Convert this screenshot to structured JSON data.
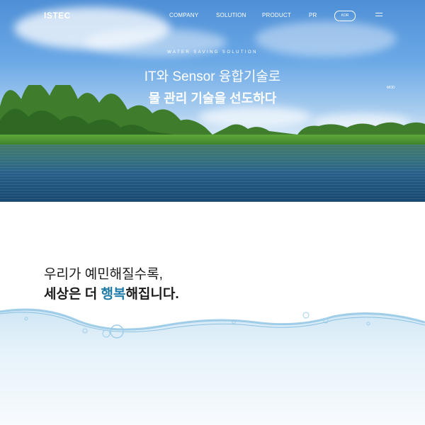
{
  "nav": {
    "logo": "ISTEC",
    "menu": [
      "COMPANY",
      "SOLUTION",
      "PRODUCT",
      "PR"
    ],
    "lang_pill": "KOR"
  },
  "hero": {
    "eyebrow": "WATER SAVING SOLUTION",
    "headline_line1": "IT와 Sensor 융합기술로",
    "headline_line2": "물 관리 기술을 선도하다",
    "side_tag": "MOD"
  },
  "intro": {
    "line1": "우리가 예민해질수록,",
    "line2_prefix": "세상은 더 ",
    "line2_accent": "행복",
    "line2_suffix": "해집니다."
  },
  "colors": {
    "accent": "#1f7ca8",
    "text": "#1b1b1b"
  },
  "icons": [
    "hamburger-menu-icon"
  ]
}
